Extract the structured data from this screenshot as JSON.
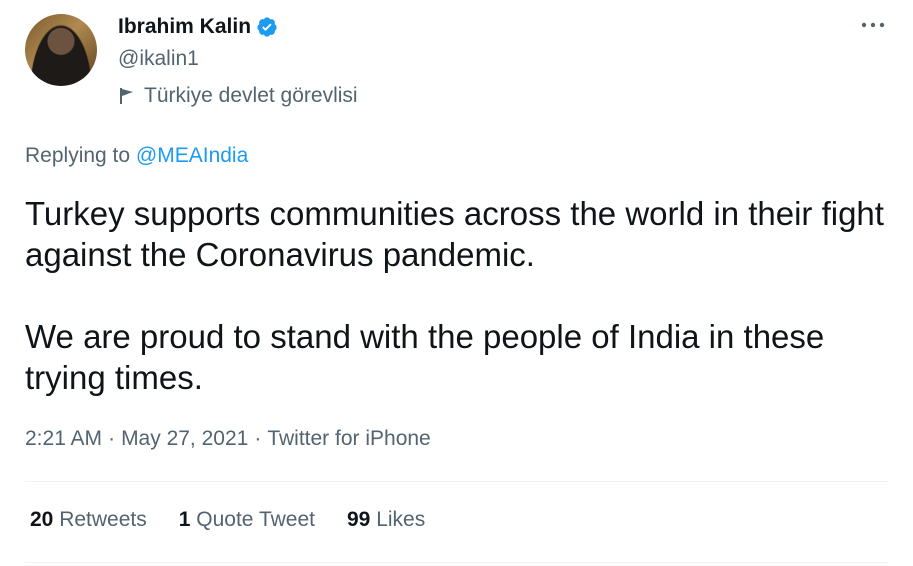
{
  "author": {
    "name": "Ibrahim Kalin",
    "handle": "@ikalin1",
    "label": "Türkiye devlet görevlisi"
  },
  "reply": {
    "prefix": "Replying to ",
    "mention": "@MEAIndia"
  },
  "tweet": {
    "paragraph1": "Turkey supports communities across the world in their fight against the Coronavirus pandemic.",
    "paragraph2": "We are proud to stand with the people of India in these trying times."
  },
  "meta": {
    "time": "2:21 AM",
    "date": "May 27, 2021",
    "source": "Twitter for iPhone",
    "separator": "·"
  },
  "stats": {
    "retweets_count": "20",
    "retweets_label": "Retweets",
    "quotes_count": "1",
    "quotes_label": "Quote Tweet",
    "likes_count": "99",
    "likes_label": "Likes"
  },
  "icons": {
    "verified": "verified-badge-icon",
    "label": "flag-icon",
    "more": "more-options-icon"
  },
  "colors": {
    "accent": "#1d9bf0",
    "secondary_text": "#536471",
    "primary_text": "#0f1419"
  }
}
